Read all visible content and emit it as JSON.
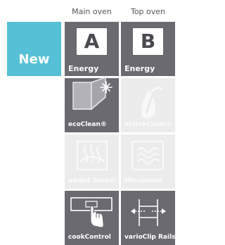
{
  "headers": {
    "main_oven": "Main oven",
    "top_oven": "Top oven"
  },
  "badge": {
    "label": "New"
  },
  "energy_tiles": [
    {
      "letter": "A",
      "label": "Energy"
    },
    {
      "letter": "B",
      "label": "Energy"
    }
  ],
  "features": [
    {
      "label": "ecoClean®",
      "active": true,
      "icon": "eco-clean-icon"
    },
    {
      "label": "activeClean®",
      "active": false,
      "icon": "active-clean-icon"
    },
    {
      "label": "added Steam",
      "active": false,
      "icon": "steam-icon"
    },
    {
      "label": "Microwave",
      "active": false,
      "icon": "microwave-icon"
    },
    {
      "label": "cookControl",
      "active": true,
      "icon": "cook-control-icon"
    },
    {
      "label": "varioClip Rails",
      "active": true,
      "icon": "vario-clip-rails-icon"
    }
  ],
  "colors": {
    "tile_active": "#6a6a70",
    "tile_inactive": "#ececec",
    "badge": "#56c0d7",
    "letter_box": "#ffffff"
  }
}
